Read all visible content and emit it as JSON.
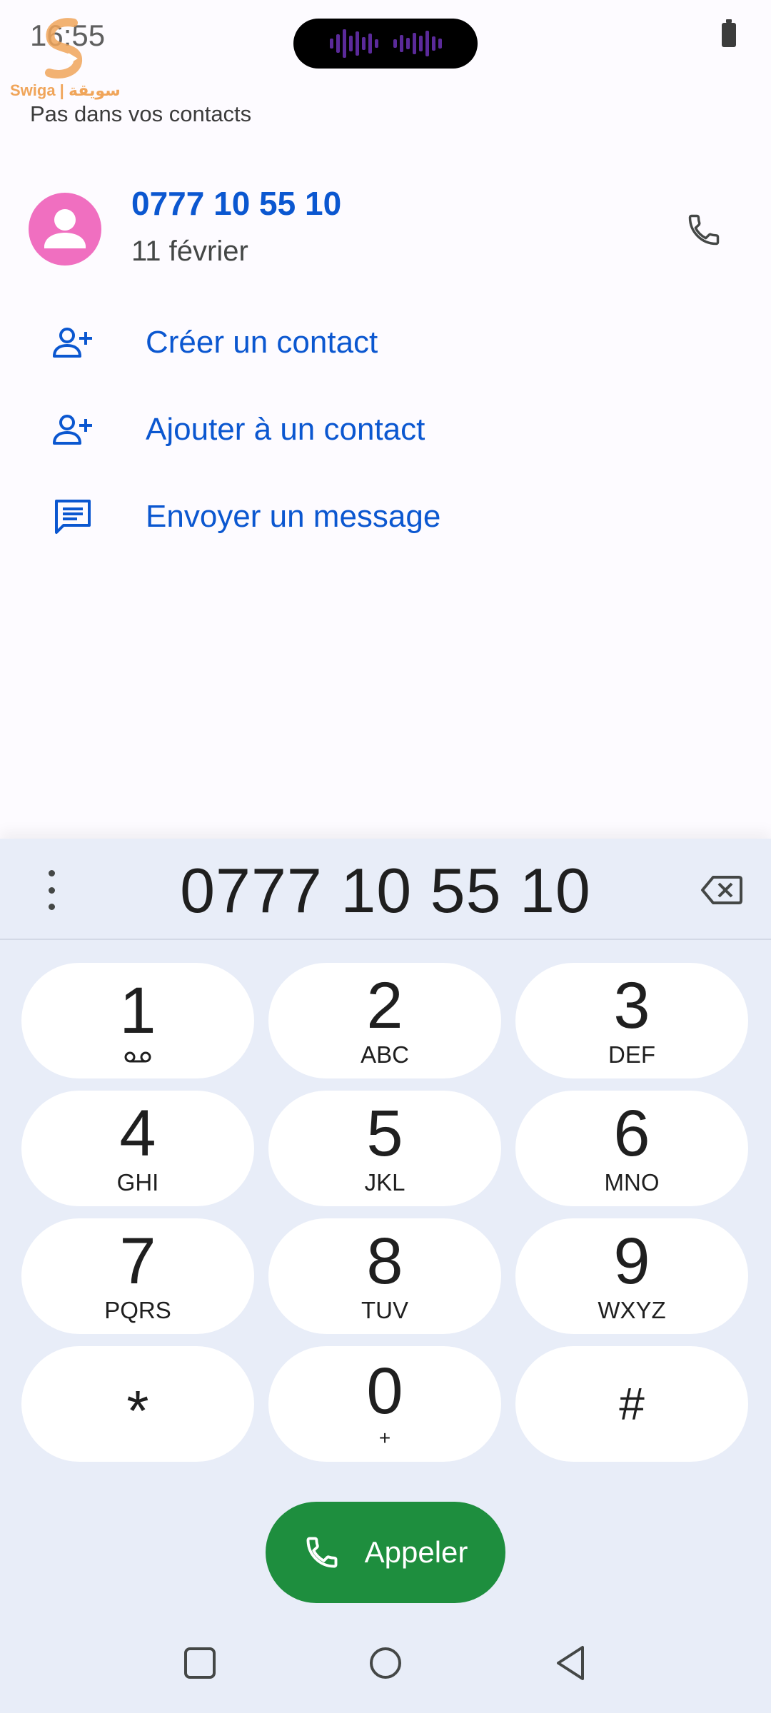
{
  "status": {
    "time": "16:55"
  },
  "watermark": {
    "text": "Swiga | سويقة"
  },
  "header": {
    "subtitle": "Pas dans vos contacts"
  },
  "contact": {
    "number": "0777 10 55 10",
    "date": "11 février",
    "avatar_color": "#f06fc0"
  },
  "actions": [
    {
      "label": "Créer un contact",
      "icon": "person-add-icon"
    },
    {
      "label": "Ajouter à un contact",
      "icon": "person-add-icon"
    },
    {
      "label": "Envoyer un message",
      "icon": "message-icon"
    }
  ],
  "dialpad": {
    "dialed_number": "0777 10 55 10",
    "keys": [
      {
        "digit": "1",
        "letters": ""
      },
      {
        "digit": "2",
        "letters": "ABC"
      },
      {
        "digit": "3",
        "letters": "DEF"
      },
      {
        "digit": "4",
        "letters": "GHI"
      },
      {
        "digit": "5",
        "letters": "JKL"
      },
      {
        "digit": "6",
        "letters": "MNO"
      },
      {
        "digit": "7",
        "letters": "PQRS"
      },
      {
        "digit": "8",
        "letters": "TUV"
      },
      {
        "digit": "9",
        "letters": "WXYZ"
      },
      {
        "digit": "*",
        "letters": ""
      },
      {
        "digit": "0",
        "letters": "+"
      },
      {
        "digit": "#",
        "letters": ""
      }
    ],
    "call_label": "Appeler",
    "call_color": "#1e8e3e"
  },
  "colors": {
    "accent": "#0b57d0",
    "dialpad_bg": "#e8edf8"
  }
}
